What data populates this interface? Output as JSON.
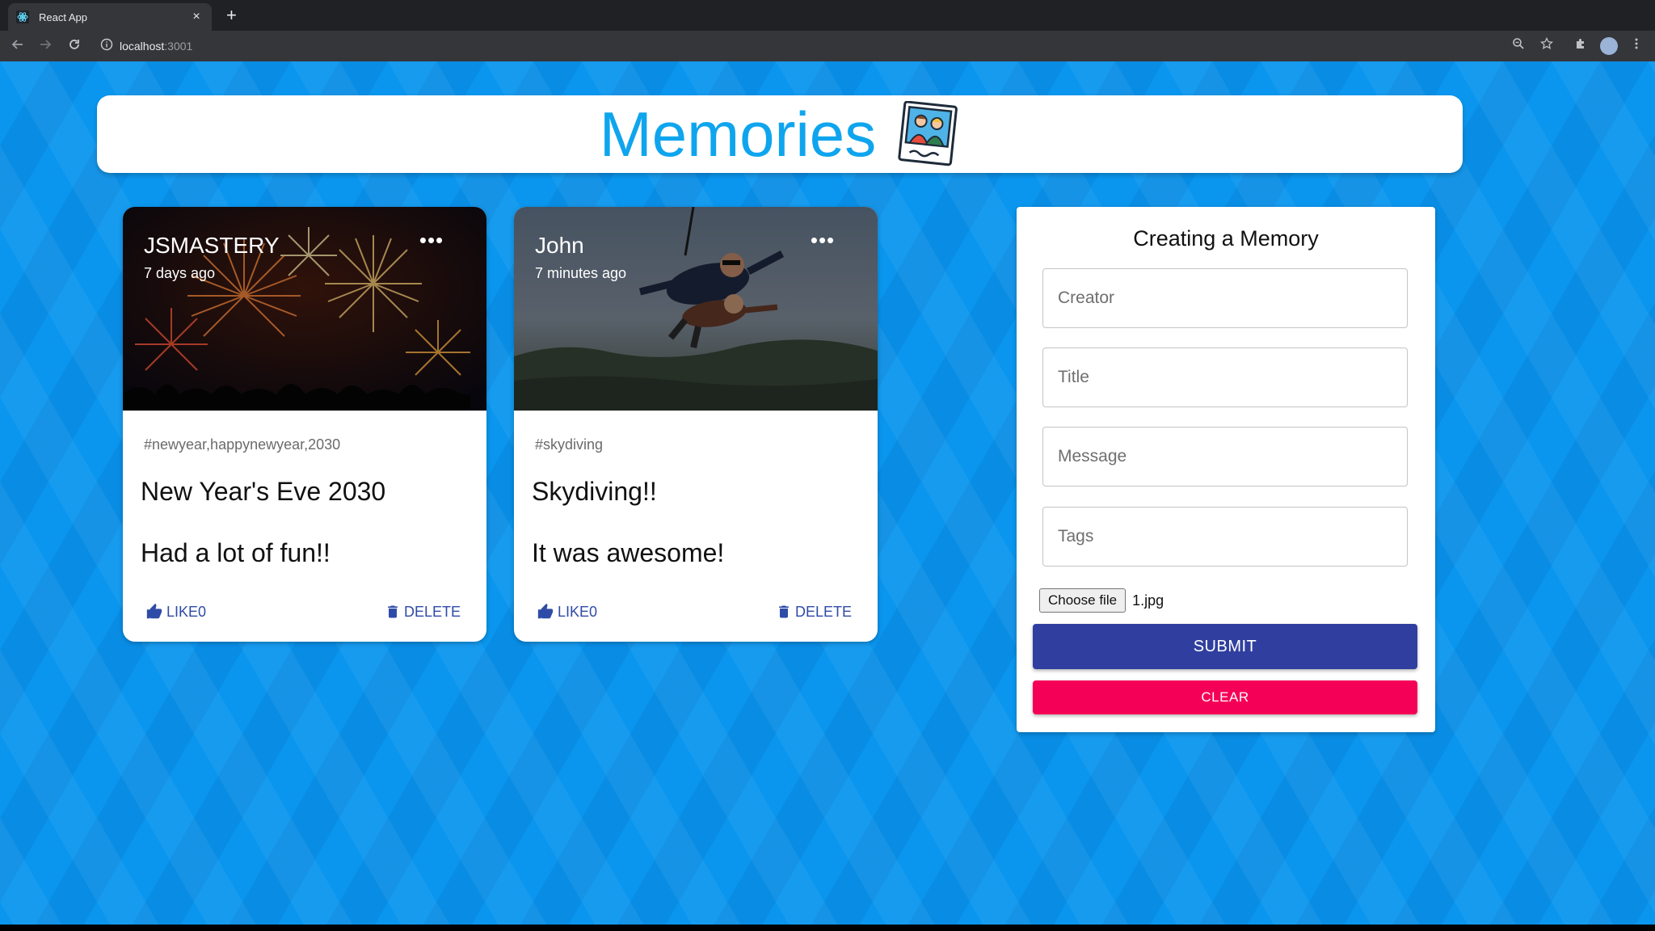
{
  "browser": {
    "tab_title": "React App",
    "tab_close": "×",
    "new_tab": "+",
    "url_host": "localhost",
    "url_port": ":3001"
  },
  "app": {
    "title": "Memories",
    "logo_icon": "memories-photo-icon"
  },
  "posts": [
    {
      "creator": "JSMASTERY",
      "time": "7 days ago",
      "more": "•••",
      "tags": "#newyear,happynewyear,2030",
      "title": "New Year's Eve 2030",
      "message": "Had a lot of fun!!",
      "like_label": "LIKE0",
      "delete_label": "DELETE",
      "image": "fireworks"
    },
    {
      "creator": "John",
      "time": "7 minutes ago",
      "more": "•••",
      "tags": "#skydiving",
      "title": "Skydiving!!",
      "message": "It was awesome!",
      "like_label": "LIKE0",
      "delete_label": "DELETE",
      "image": "skydiving"
    }
  ],
  "form": {
    "heading": "Creating a Memory",
    "creator_placeholder": "Creator",
    "title_placeholder": "Title",
    "message_placeholder": "Message",
    "tags_placeholder": "Tags",
    "file_button": "Choose file",
    "file_name": "1.jpg",
    "submit_label": "SUBMIT",
    "clear_label": "CLEAR"
  },
  "colors": {
    "background": "#0a96ee",
    "title_blue": "#0fa5ee",
    "primary": "#303f9f",
    "secondary": "#f50057",
    "card_action": "#2f4ba8"
  }
}
